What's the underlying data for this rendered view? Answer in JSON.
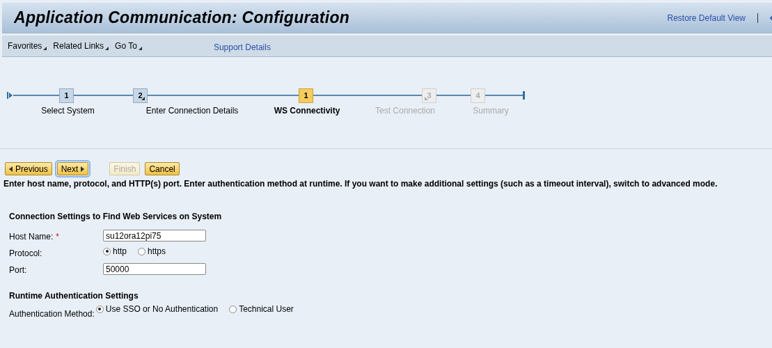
{
  "window": {
    "title": "Application Communication: Configuration"
  },
  "header_links": [
    {
      "label": "Restore Default View"
    }
  ],
  "toolbar": {
    "menus": [
      {
        "label": "Favorites"
      },
      {
        "label": "Related Links"
      },
      {
        "label": "Go To"
      }
    ],
    "links": [
      {
        "label": "Support Details"
      }
    ]
  },
  "roadmap": {
    "steps": [
      {
        "number": "1",
        "label": "Select System",
        "selected": false,
        "disabled": false,
        "substeps": false
      },
      {
        "number": "2",
        "label": "Enter Connection Details",
        "selected": false,
        "disabled": false,
        "substeps": true
      },
      {
        "number": "1",
        "label": "WS Connectivity",
        "selected": true,
        "disabled": false,
        "substeps": false
      },
      {
        "number": "3",
        "label": "Test Connection",
        "selected": false,
        "disabled": true,
        "substeps": true
      },
      {
        "number": "4",
        "label": "Summary",
        "selected": false,
        "disabled": true,
        "substeps": false
      }
    ]
  },
  "button_groups": [
    [
      {
        "label": "Previous",
        "kind": "back",
        "disabled": false,
        "focused": false
      },
      {
        "label": "Next",
        "kind": "forward",
        "disabled": false,
        "focused": true
      }
    ],
    [
      {
        "label": "Finish",
        "kind": "plain",
        "disabled": true,
        "focused": false
      },
      {
        "label": "Cancel",
        "kind": "plain",
        "disabled": false,
        "focused": false
      }
    ]
  ],
  "instruction": "Enter host name, protocol, and HTTP(s) port. Enter authentication method at runtime. If you want to make additional settings (such as a timeout interval), switch to advanced mode.",
  "sections": [
    {
      "title": "Connection Settings to Find Web Services on System",
      "fields": [
        {
          "kind": "text",
          "label": "Host Name:",
          "required_mark": "*",
          "value": "su12ora12pi75"
        },
        {
          "kind": "radio",
          "label": "Protocol:",
          "options": [
            {
              "label": "http",
              "selected": true
            },
            {
              "label": "https",
              "selected": false
            }
          ]
        },
        {
          "kind": "text",
          "label": "Port:",
          "value": "50000"
        }
      ]
    },
    {
      "title": "Runtime Authentication Settings",
      "fields": [
        {
          "kind": "radio",
          "label": "Authentication Method:",
          "options": [
            {
              "label": "Use SSO or No Authentication",
              "selected": true
            },
            {
              "label": "Technical User",
              "selected": false
            }
          ]
        }
      ]
    }
  ]
}
